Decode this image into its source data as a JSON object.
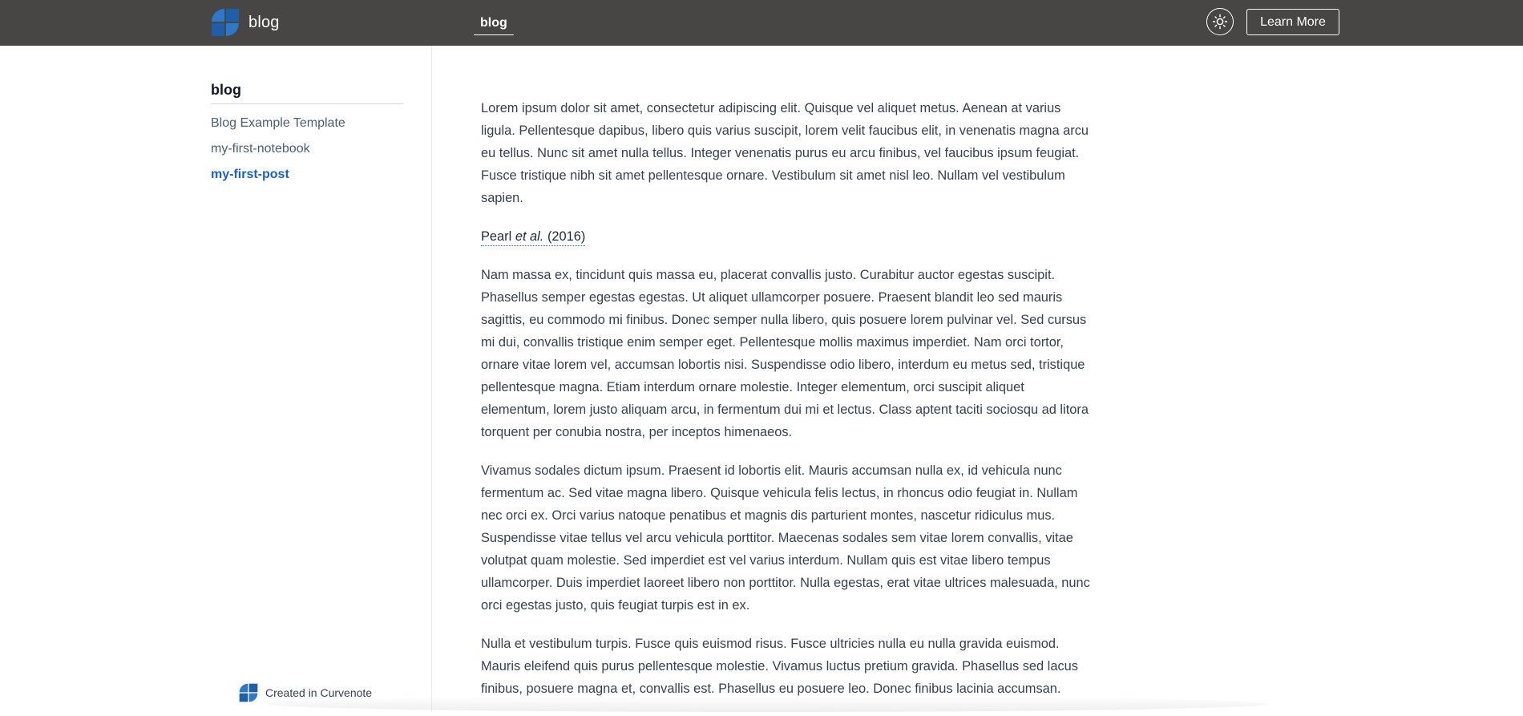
{
  "header": {
    "brand_title": "blog",
    "nav_tab": "blog",
    "theme_icon": "sun-icon",
    "learn_more_label": "Learn More"
  },
  "sidebar": {
    "heading": "blog",
    "items": [
      {
        "label": "Blog Example Template",
        "active": false
      },
      {
        "label": "my-first-notebook",
        "active": false
      },
      {
        "label": "my-first-post",
        "active": true
      }
    ],
    "footer_label": "Created in Curvenote"
  },
  "article": {
    "paragraph_1": "Lorem ipsum dolor sit amet, consectetur adipiscing elit. Quisque vel aliquet metus. Aenean at varius ligula. Pellentesque dapibus, libero quis varius suscipit, lorem velit faucibus elit, in venenatis magna arcu eu tellus. Nunc sit amet nulla tellus. Integer venenatis purus eu arcu finibus, vel faucibus ipsum feugiat. Fusce tristique nibh sit amet pellentesque ornare. Vestibulum sit amet nisl leo. Nullam vel vestibulum sapien.",
    "citation": {
      "author": "Pearl",
      "etal": "et al.",
      "year": "(2016)"
    },
    "paragraph_2": "Nam massa ex, tincidunt quis massa eu, placerat convallis justo. Curabitur auctor egestas suscipit. Phasellus semper egestas egestas. Ut aliquet ullamcorper posuere. Praesent blandit leo sed mauris sagittis, eu commodo mi finibus. Donec semper nulla libero, quis posuere lorem pulvinar vel. Sed cursus mi dui, convallis tristique enim semper eget. Pellentesque mollis maximus imperdiet. Nam orci tortor, ornare vitae lorem vel, accumsan lobortis nisi. Suspendisse odio libero, interdum eu metus sed, tristique pellentesque magna. Etiam interdum ornare molestie. Integer elementum, orci suscipit aliquet elementum, lorem justo aliquam arcu, in fermentum dui mi et lectus. Class aptent taciti sociosqu ad litora torquent per conubia nostra, per inceptos himenaeos.",
    "paragraph_3": "Vivamus sodales dictum ipsum. Praesent id lobortis elit. Mauris accumsan nulla ex, id vehicula nunc fermentum ac. Sed vitae magna libero. Quisque vehicula felis lectus, in rhoncus odio feugiat in. Nullam nec orci ex. Orci varius natoque penatibus et magnis dis parturient montes, nascetur ridiculus mus. Suspendisse vitae tellus vel arcu vehicula porttitor. Maecenas sodales sem vitae lorem convallis, vitae volutpat quam molestie. Sed imperdiet est vel varius interdum. Nullam quis est vitae libero tempus ullamcorper. Duis imperdiet laoreet libero non porttitor. Nulla egestas, erat vitae ultrices malesuada, nunc orci egestas justo, quis feugiat turpis est in ex.",
    "paragraph_4": "Nulla et vestibulum turpis. Fusce quis euismod risus. Fusce ultricies nulla eu nulla gravida euismod. Mauris eleifend quis purus pellentesque molestie. Vivamus luctus pretium gravida. Phasellus sed lacus finibus, posuere magna et, convallis est. Phasellus eu posuere leo. Donec finibus lacinia accumsan."
  },
  "colors": {
    "topbar": "#474645",
    "active_link": "#1d5fcf",
    "logo_blue": "#1f5ea8"
  }
}
